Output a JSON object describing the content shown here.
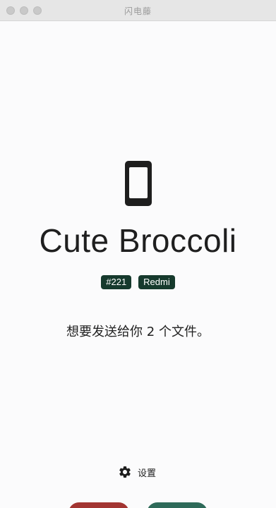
{
  "window": {
    "title": "闪电藤"
  },
  "device": {
    "icon": "phone-icon",
    "name": "Cute Broccoli",
    "badges": [
      "#221",
      "Redmi"
    ]
  },
  "message": "想要发送给你 2 个文件。",
  "settings": {
    "icon": "gear-icon",
    "label": "设置"
  },
  "colors": {
    "badge_bg": "#163a2d",
    "decline": "#a33532",
    "accept": "#2e6a59"
  }
}
